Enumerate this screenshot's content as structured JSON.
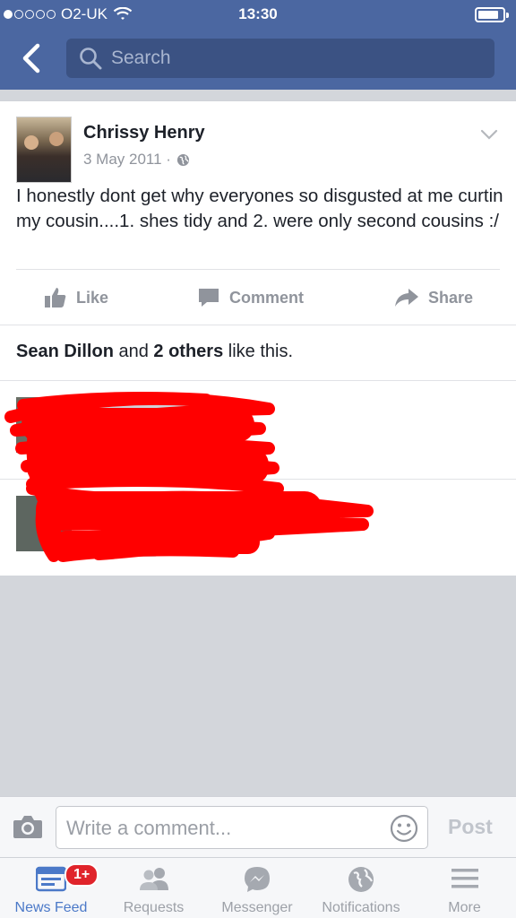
{
  "status": {
    "carrier": "O2-UK",
    "time": "13:30"
  },
  "header": {
    "search_placeholder": "Search"
  },
  "post": {
    "author": "Chrissy Henry",
    "date": "3 May 2011 ·",
    "text": "I honestly dont get why everyones so disgusted at me curtin my cousin....1. shes tidy and 2. were only second cousins :/",
    "actions": {
      "like": "Like",
      "comment": "Comment",
      "share": "Share"
    },
    "likes": {
      "name": "Sean Dillon",
      "and": " and ",
      "others": "2 others",
      "suffix": " like this."
    }
  },
  "composer": {
    "placeholder": "Write a comment...",
    "post_label": "Post"
  },
  "tabs": [
    {
      "label": "News Feed",
      "icon": "news-feed-icon",
      "active": true,
      "badge": "1+"
    },
    {
      "label": "Requests",
      "icon": "requests-icon"
    },
    {
      "label": "Messenger",
      "icon": "messenger-icon"
    },
    {
      "label": "Notifications",
      "icon": "notifications-icon"
    },
    {
      "label": "More",
      "icon": "more-icon"
    }
  ],
  "colors": {
    "brand": "#4b67a1",
    "active_tab": "#4b79c8",
    "badge": "#e0242b",
    "redaction": "#ff0000"
  }
}
